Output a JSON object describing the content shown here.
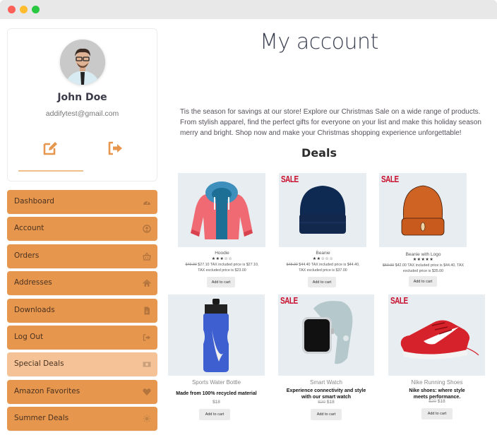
{
  "window": {
    "controls": [
      "close",
      "minimize",
      "maximize"
    ]
  },
  "profile": {
    "name": "John Doe",
    "email": "addifytest@gmail.com",
    "actions": [
      {
        "name": "edit",
        "icon": "edit-icon"
      },
      {
        "name": "logout",
        "icon": "sign-out-icon"
      }
    ]
  },
  "menu": {
    "items": [
      {
        "label": "Dashboard",
        "icon": "tachometer-icon",
        "active": false
      },
      {
        "label": "Account",
        "icon": "user-circle-icon",
        "active": false
      },
      {
        "label": "Orders",
        "icon": "shopping-basket-icon",
        "active": false
      },
      {
        "label": "Addresses",
        "icon": "home-icon",
        "active": false
      },
      {
        "label": "Downloads",
        "icon": "file-download-icon",
        "active": false
      },
      {
        "label": "Log Out",
        "icon": "sign-out-icon",
        "active": false
      },
      {
        "label": "Special Deals",
        "icon": "money-bill-icon",
        "active": true
      },
      {
        "label": "Amazon Favorites",
        "icon": "heart-icon",
        "active": false
      },
      {
        "label": "Summer Deals",
        "icon": "sun-icon",
        "active": false
      }
    ]
  },
  "colors": {
    "menu_bg": "#e6964d",
    "menu_active_bg": "#f4c296",
    "accent": "#e6964d",
    "sale_badge": "#c8102e"
  },
  "main": {
    "title": "My account",
    "intro": "Tis the season for savings at our store! Explore our Christmas Sale on a wide range of products. From stylish apparel, find the perfect gifts for everyone on your list and make this holiday season merry and bright. Shop now and make your Christmas shopping experience unforgettable!",
    "deals_title": "Deals",
    "add_to_cart_label": "Add to cart",
    "products_row1": [
      {
        "name": "Hoodie",
        "sale": false,
        "rating": 3,
        "rating_max": 5,
        "old_price": "$49.00",
        "price_text": "$27.10 TAX included price is $27.10, TAX excluded price is $23.00"
      },
      {
        "name": "Beanie",
        "sale": true,
        "sale_label": "SALE",
        "rating": 2,
        "rating_max": 5,
        "old_price": "$48.00",
        "price_text": "$44.40 TAX included price is $44.40, TAX excluded price is $37.00"
      },
      {
        "name": "Beanie with Logo",
        "sale": true,
        "sale_label": "SALE",
        "rating": 5,
        "rating_max": 5,
        "old_price": "$50.00",
        "price_text": "$42.00 TAX included price is $44.40, TAX excluded price is $35.00"
      }
    ],
    "products_row2": [
      {
        "name": "Sports Water Bottle",
        "sale": false,
        "description": "Made from 100% recycled material",
        "old_price": "",
        "price": "$18"
      },
      {
        "name": "Smart Watch",
        "sale": true,
        "sale_label": "SALE",
        "description": "Experience connectivity and style with our smart watch",
        "old_price": "$20",
        "price": "$18"
      },
      {
        "name": "Nike Running Shoes",
        "sale": true,
        "sale_label": "SALE",
        "description": "Nike shoes: where style meets performance.",
        "old_price": "$20",
        "price": "$18"
      }
    ]
  }
}
